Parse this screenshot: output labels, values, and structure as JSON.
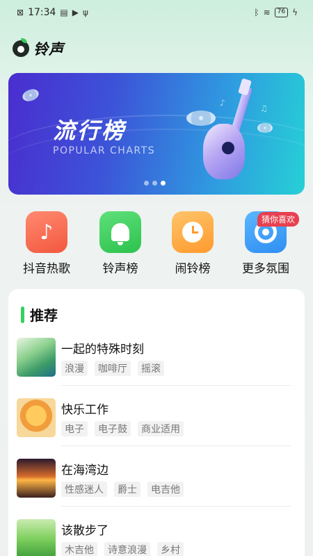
{
  "status_bar": {
    "time": "17:34",
    "battery": "76"
  },
  "app": {
    "title": "铃声"
  },
  "banner": {
    "title": "流行榜",
    "subtitle": "POPULAR CHARTS",
    "active_slide": 3,
    "slide_count": 3
  },
  "categories": [
    {
      "label": "抖音热歌",
      "icon": "douyin-note-icon",
      "color": "#f2573f"
    },
    {
      "label": "铃声榜",
      "icon": "bell-icon",
      "color": "#2cc24d"
    },
    {
      "label": "闹铃榜",
      "icon": "alarm-clock-icon",
      "color": "#ff9a2d"
    },
    {
      "label": "更多氛围",
      "icon": "music-disc-icon",
      "color": "#2f8ef2",
      "badge": "猜你喜欢"
    }
  ],
  "recommend": {
    "title": "推荐",
    "accent": "#35d05e",
    "items": [
      {
        "title": "一起的特殊时刻",
        "tags": [
          "浪漫",
          "咖啡厅",
          "摇滚"
        ]
      },
      {
        "title": "快乐工作",
        "tags": [
          "电子",
          "电子鼓",
          "商业适用"
        ]
      },
      {
        "title": "在海湾边",
        "tags": [
          "性感迷人",
          "爵士",
          "电吉他"
        ]
      },
      {
        "title": "该散步了",
        "tags": [
          "木吉他",
          "诗意浪漫",
          "乡村"
        ]
      }
    ]
  }
}
